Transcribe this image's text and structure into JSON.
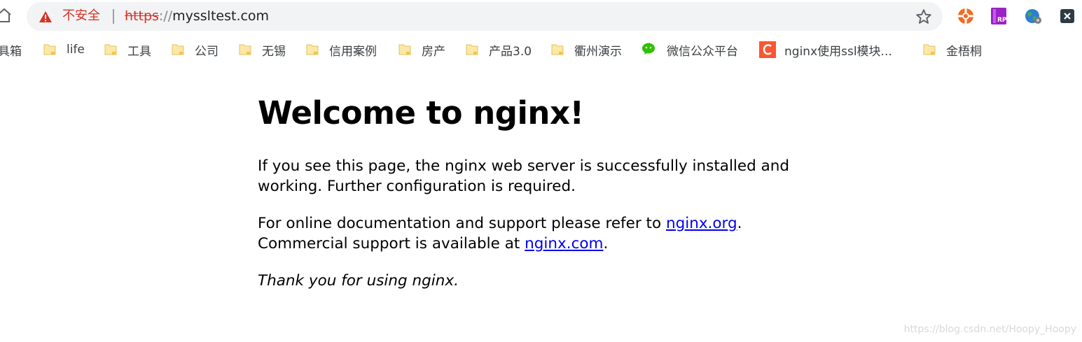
{
  "toolbar": {
    "home_icon": "home-icon",
    "security_label": "不安全",
    "url_scheme": "https",
    "url_separator": "://",
    "url_host": "myssltest.com",
    "star_icon": "bookmark-star-icon",
    "extensions": [
      "orange-lifebuoy-icon",
      "axure-rp-icon",
      "globe-icon",
      "dark-x-icon"
    ]
  },
  "bookmarks": {
    "items": [
      {
        "label": "具箱",
        "icon": "none"
      },
      {
        "label": "life",
        "icon": "folder-icon"
      },
      {
        "label": "工具",
        "icon": "folder-icon"
      },
      {
        "label": "公司",
        "icon": "folder-icon"
      },
      {
        "label": "无锡",
        "icon": "folder-icon"
      },
      {
        "label": "信用案例",
        "icon": "folder-icon"
      },
      {
        "label": "房产",
        "icon": "folder-icon"
      },
      {
        "label": "产品3.0",
        "icon": "folder-icon"
      },
      {
        "label": "衢州演示",
        "icon": "folder-icon"
      },
      {
        "label": "微信公众平台",
        "icon": "wechat-icon"
      },
      {
        "label": "nginx使用ssl模块...",
        "icon": "csdn-icon"
      },
      {
        "label": "金梧桐",
        "icon": "folder-icon"
      }
    ]
  },
  "page": {
    "heading": "Welcome to nginx!",
    "p1": "If you see this page, the nginx web server is successfully installed and working. Further configuration is required.",
    "p2_text1": "For online documentation and support please refer to ",
    "p2_link1": "nginx.org",
    "p2_text2": ".",
    "p2_text3": "Commercial support is available at ",
    "p2_link2": "nginx.com",
    "p2_text4": ".",
    "p3": "Thank you for using nginx."
  },
  "watermark": "https://blog.csdn.net/Hoopy_Hoopy",
  "colors": {
    "insecure_red": "#d93025",
    "link_blue": "#0000ee",
    "omnibox_bg": "#f1f3f4",
    "folder_yellow": "#fce8a6"
  }
}
